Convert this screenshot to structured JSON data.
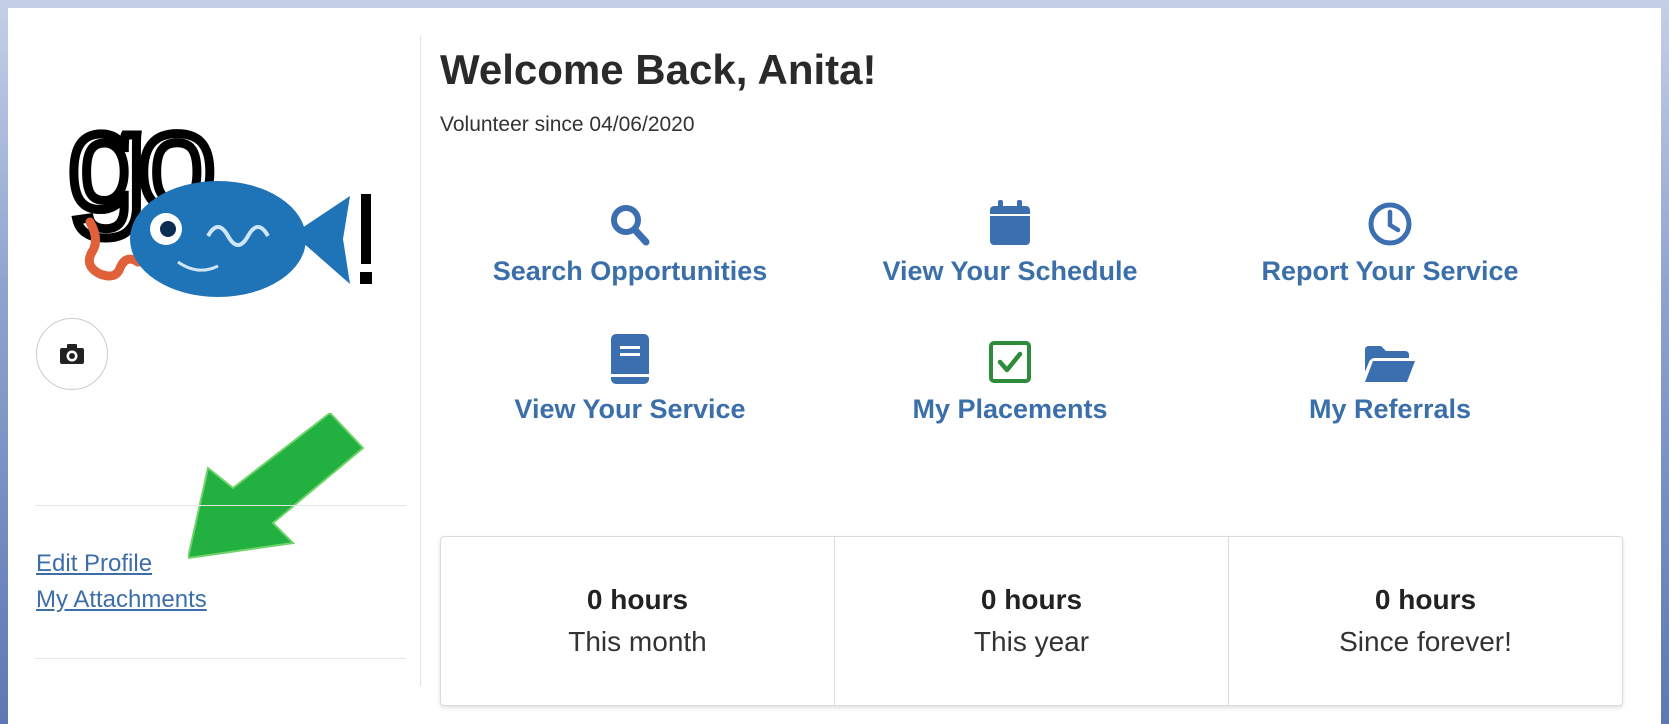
{
  "profile": {
    "edit_profile_link": "Edit Profile",
    "attachments_link": "My Attachments"
  },
  "header": {
    "welcome": "Welcome Back, Anita!",
    "volunteer_since": "Volunteer since 04/06/2020"
  },
  "actions": [
    {
      "label": "Search Opportunities",
      "icon": "search-icon"
    },
    {
      "label": "View Your Schedule",
      "icon": "calendar-icon"
    },
    {
      "label": "Report Your Service",
      "icon": "clock-icon"
    },
    {
      "label": "View Your Service",
      "icon": "book-icon"
    },
    {
      "label": "My Placements",
      "icon": "checkbox-icon"
    },
    {
      "label": "My Referrals",
      "icon": "folder-open-icon"
    }
  ],
  "stats": [
    {
      "value": "0 hours",
      "caption": "This month"
    },
    {
      "value": "0 hours",
      "caption": "This year"
    },
    {
      "value": "0 hours",
      "caption": "Since forever!"
    }
  ],
  "colors": {
    "link": "#3d6ea8",
    "action_label": "#3a6fa9",
    "icon_blue": "#3c6fb0",
    "check_green": "#2e8b3a",
    "arrow_green": "#22b041",
    "fish_blue": "#1f73b7"
  }
}
